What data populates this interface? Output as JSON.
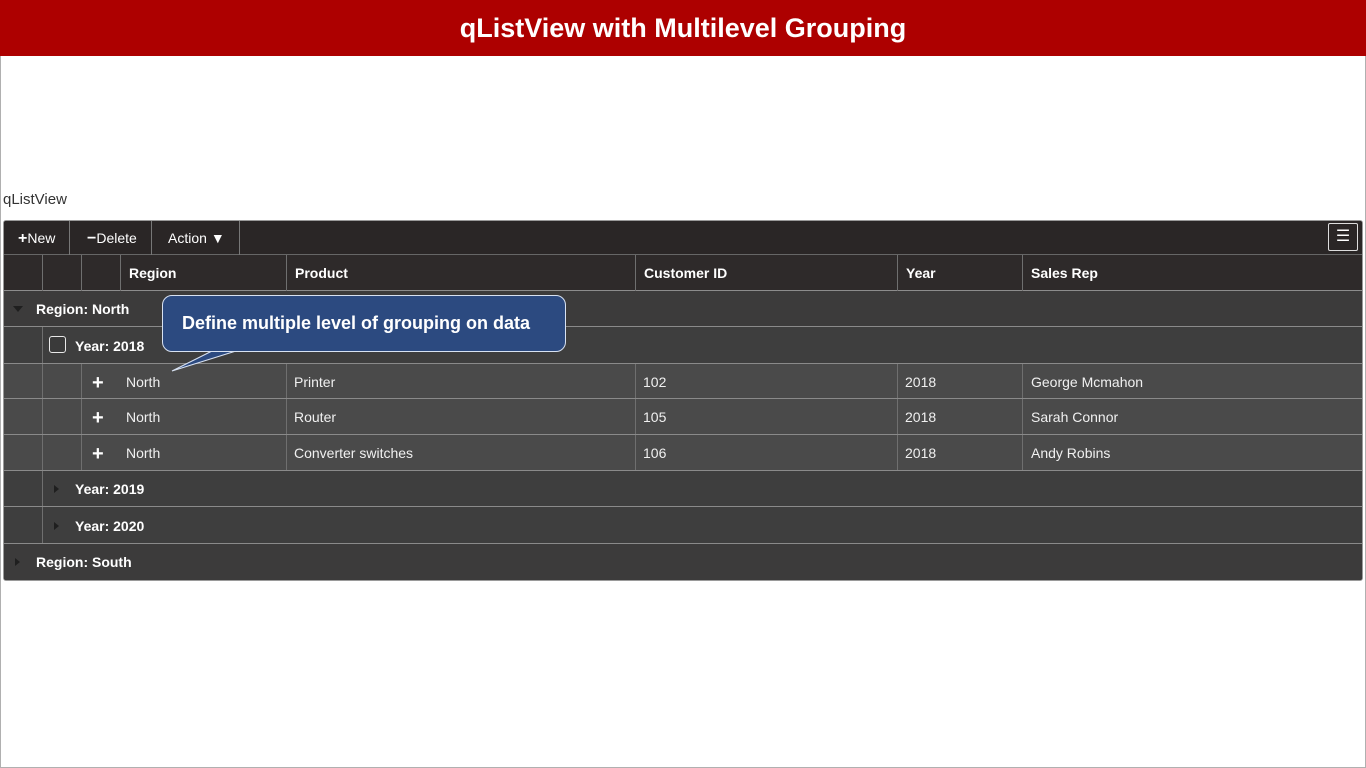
{
  "banner": {
    "title": "qListView with Multilevel Grouping"
  },
  "widget": {
    "label": "qListView"
  },
  "toolbar": {
    "new_label": "New",
    "delete_label": "Delete",
    "action_label": "Action"
  },
  "columns": [
    "Region",
    "Product",
    "Customer ID",
    "Year",
    "Sales Rep"
  ],
  "groups": {
    "north": "Region: North",
    "year2018": "Year: 2018",
    "year2019": "Year: 2019",
    "year2020": "Year: 2020",
    "south": "Region: South"
  },
  "rows": [
    {
      "region": "North",
      "product": "Printer",
      "customer_id": "102",
      "year": "2018",
      "sales_rep": "George Mcmahon"
    },
    {
      "region": "North",
      "product": "Router",
      "customer_id": "105",
      "year": "2018",
      "sales_rep": "Sarah Connor"
    },
    {
      "region": "North",
      "product": "Converter switches",
      "customer_id": "106",
      "year": "2018",
      "sales_rep": "Andy Robins"
    }
  ],
  "tooltip": {
    "text": "Define multiple level of grouping on data"
  },
  "colors": {
    "banner": "#ad0000",
    "tooltip": "#2c4a80",
    "grid_bg": "#3c3c3c"
  }
}
